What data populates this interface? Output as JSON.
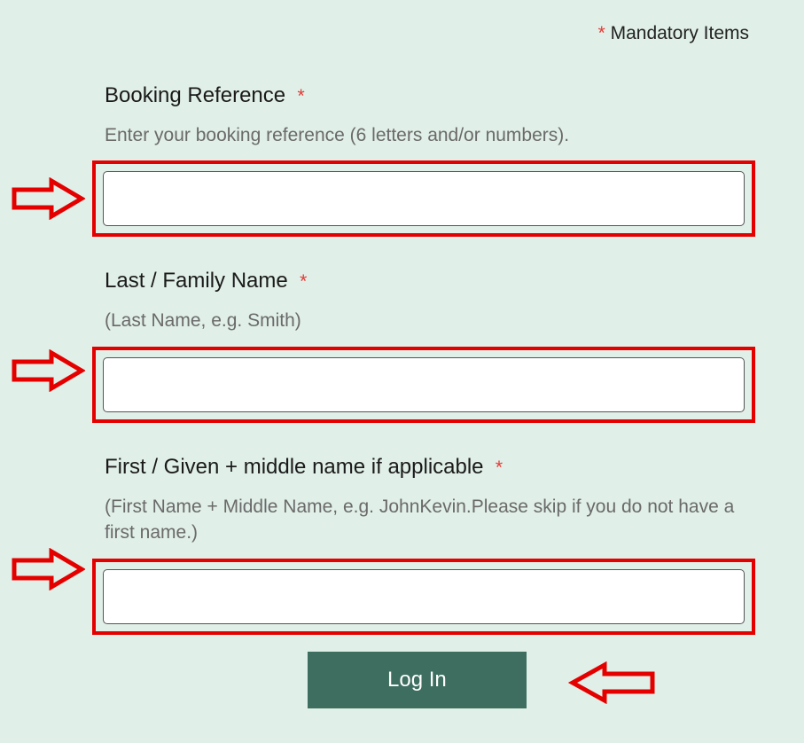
{
  "header": {
    "mandatory_note": " Mandatory Items",
    "asterisk": "*"
  },
  "fields": {
    "bookingRef": {
      "label": "Booking Reference ",
      "asterisk": "*",
      "hint": "Enter your booking reference (6 letters and/or numbers).",
      "value": ""
    },
    "lastName": {
      "label": "Last / Family Name ",
      "asterisk": "*",
      "hint": "(Last Name, e.g. Smith)",
      "value": ""
    },
    "firstName": {
      "label": "First / Given + middle name if applicable ",
      "asterisk": "*",
      "hint": "(First Name + Middle Name, e.g. JohnKevin.Please skip if you do not have a first name.)",
      "value": ""
    }
  },
  "actions": {
    "login_label": "Log In"
  }
}
